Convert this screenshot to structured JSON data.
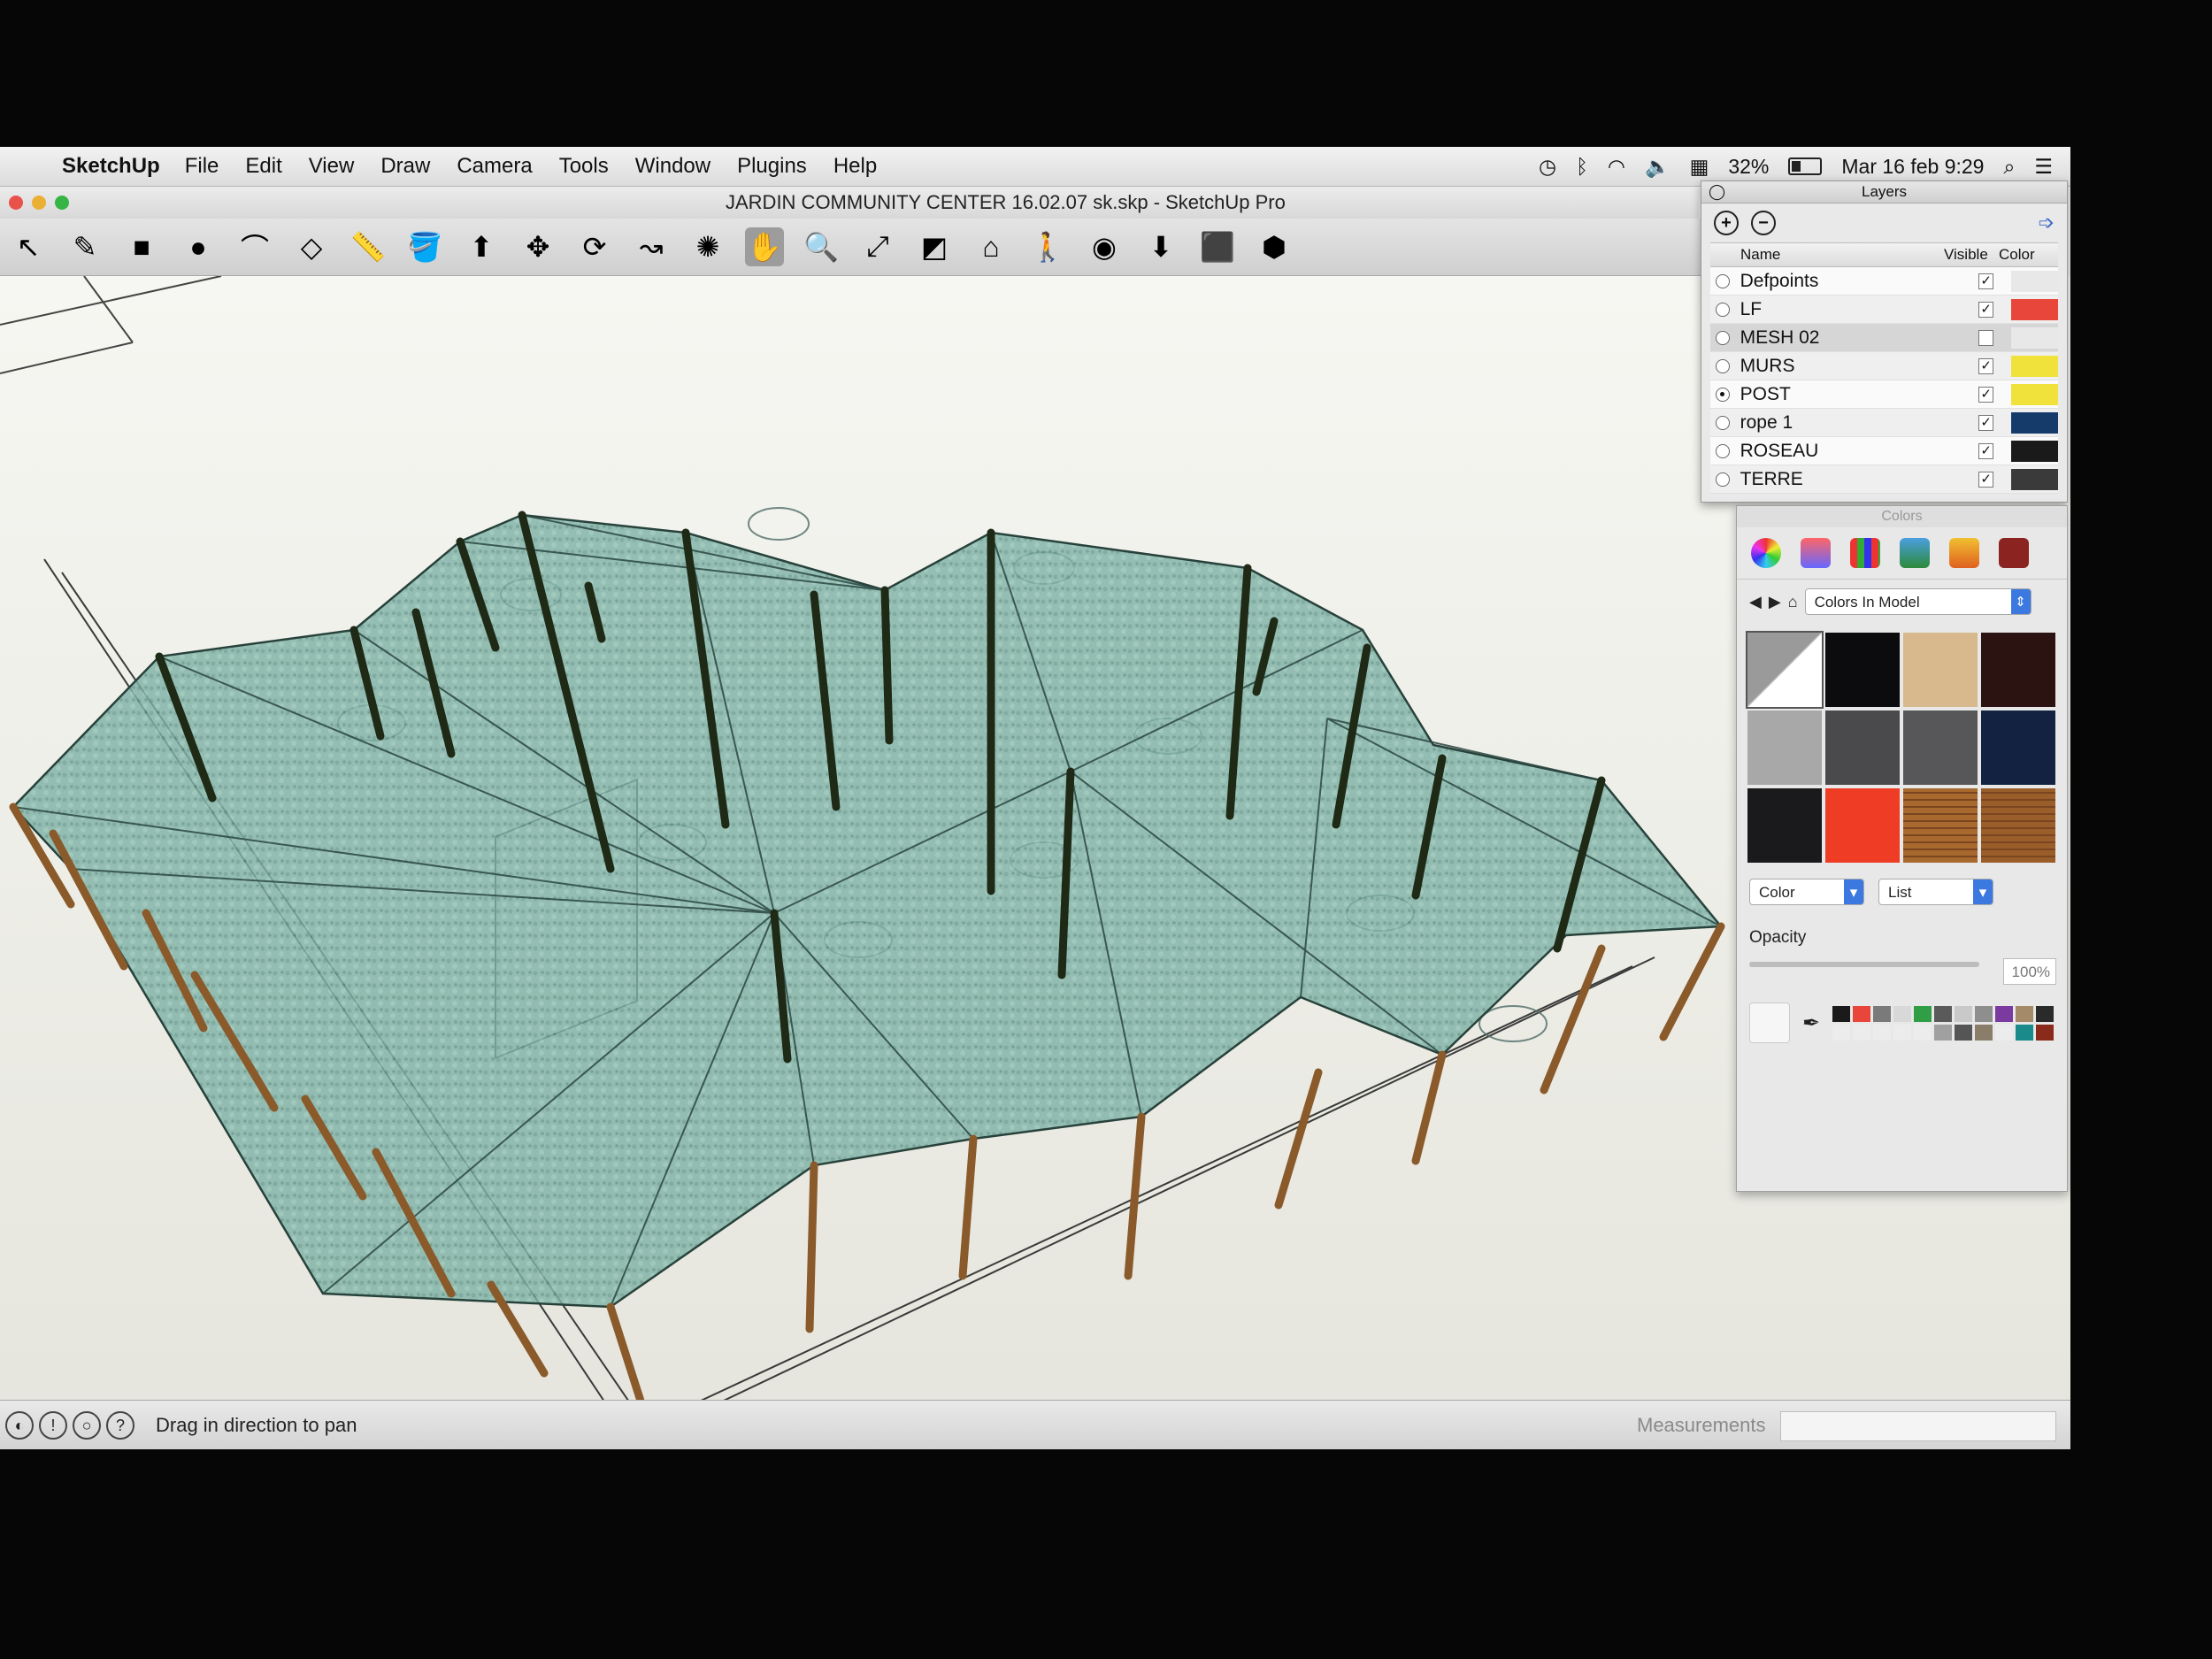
{
  "menubar": {
    "app_name": "SketchUp",
    "items": [
      "File",
      "Edit",
      "View",
      "Draw",
      "Camera",
      "Tools",
      "Window",
      "Plugins",
      "Help"
    ],
    "battery": "32%",
    "datetime": "Mar 16 feb  9:29",
    "status_icons": [
      "time-machine-icon",
      "bluetooth-icon",
      "wifi-icon",
      "volume-icon",
      "keyboard-flag-icon",
      "battery-icon",
      "spotlight-search-icon",
      "notification-list-icon"
    ]
  },
  "window": {
    "title": "JARDIN COMMUNITY CENTER 16.02.07 sk.skp - SketchUp Pro"
  },
  "toolbar": {
    "tools": [
      {
        "name": "select-tool-icon",
        "glyph": "↖"
      },
      {
        "name": "pencil-tool-icon",
        "glyph": "✎"
      },
      {
        "name": "rectangle-tool-icon",
        "glyph": "■"
      },
      {
        "name": "circle-tool-icon",
        "glyph": "●"
      },
      {
        "name": "arc-tool-icon",
        "glyph": "⌒"
      },
      {
        "name": "eraser-tool-icon",
        "glyph": "◇"
      },
      {
        "name": "tape-measure-tool-icon",
        "glyph": "📏"
      },
      {
        "name": "paint-bucket-tool-icon",
        "glyph": "🪣"
      },
      {
        "name": "push-pull-tool-icon",
        "glyph": "⬆"
      },
      {
        "name": "move-tool-icon",
        "glyph": "✥"
      },
      {
        "name": "rotate-tool-icon",
        "glyph": "⟳"
      },
      {
        "name": "follow-me-tool-icon",
        "glyph": "↝"
      },
      {
        "name": "orbit-tool-icon",
        "glyph": "✺"
      },
      {
        "name": "pan-tool-icon",
        "glyph": "✋"
      },
      {
        "name": "zoom-tool-icon",
        "glyph": "🔍"
      },
      {
        "name": "zoom-extents-tool-icon",
        "glyph": "⤢"
      },
      {
        "name": "section-plane-tool-icon",
        "glyph": "◩"
      },
      {
        "name": "warehouse-tool-icon",
        "glyph": "⌂"
      },
      {
        "name": "walk-tool-icon",
        "glyph": "🚶"
      },
      {
        "name": "get-models-tool-icon",
        "glyph": "◉"
      },
      {
        "name": "share-model-tool-icon",
        "glyph": "⬇"
      },
      {
        "name": "components-tool-icon",
        "glyph": "⬛"
      },
      {
        "name": "extension-tool-icon",
        "glyph": "⬢"
      }
    ],
    "active_index": 13
  },
  "layers": {
    "title": "Layers",
    "headers": {
      "name": "Name",
      "visible": "Visible",
      "color": "Color"
    },
    "rows": [
      {
        "name": "Defpoints",
        "visible": true,
        "color": "#e8e8e8",
        "current": false
      },
      {
        "name": "LF",
        "visible": true,
        "color": "#e8463a",
        "current": false
      },
      {
        "name": "MESH 02",
        "visible": false,
        "color": "#e8e8e8",
        "current": false
      },
      {
        "name": "MURS",
        "visible": true,
        "color": "#f0e23a",
        "current": false
      },
      {
        "name": "POST",
        "visible": true,
        "color": "#f0e23a",
        "current": true
      },
      {
        "name": "rope 1",
        "visible": true,
        "color": "#153b6b",
        "current": false
      },
      {
        "name": "ROSEAU",
        "visible": true,
        "color": "#1a1a1a",
        "current": false
      },
      {
        "name": "TERRE",
        "visible": true,
        "color": "#3a3a3a",
        "current": false
      }
    ]
  },
  "colors": {
    "title": "Colors",
    "collection": "Colors In Model",
    "swatches": [
      "#ffffff",
      "#0c0c0e",
      "#d7b98d",
      "#2a1310",
      "#a8a8a8",
      "#4a4a4c",
      "#575759",
      "#122240",
      "#1a1a1c",
      "#ef3c25",
      "#a8692e",
      "#9a5e2a"
    ],
    "mode_select": "Color",
    "list_select": "List",
    "opacity_label": "Opacity",
    "opacity_value": "100%",
    "opacity": 1.0,
    "palette": [
      "#1a1a1a",
      "#e8463a",
      "#7a7a7a",
      "#d8d8d8",
      "#2f9e44",
      "#5a5a5a",
      "#c9c9c9",
      "#8e8e8e",
      "#7b3aa0",
      "#a58a6a",
      "#2a2a2a",
      "#ececec",
      "#ececec",
      "#ececec",
      "#ececec",
      "#ececec",
      "#a0a0a0",
      "#555555",
      "#8a7e6a",
      "#ececec",
      "#1a8a8a",
      "#8a2a1a"
    ]
  },
  "statusbar": {
    "hint": "Drag in direction to pan",
    "measurements_label": "Measurements"
  }
}
